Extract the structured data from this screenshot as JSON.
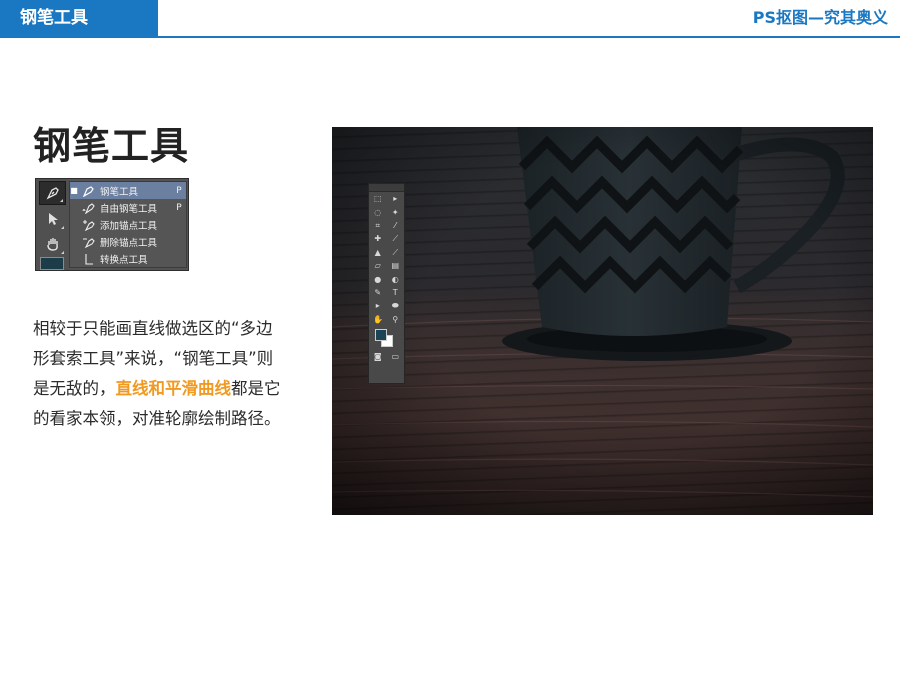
{
  "header": {
    "section_tab": "钢笔工具",
    "course_title": "PS抠图—究其奥义"
  },
  "main": {
    "title": "钢笔工具"
  },
  "pen_flyout": {
    "items": [
      {
        "label": "钢笔工具",
        "shortcut": "P",
        "selected": true
      },
      {
        "label": "自由钢笔工具",
        "shortcut": "P",
        "selected": false
      },
      {
        "label": "添加锚点工具",
        "shortcut": "",
        "selected": false
      },
      {
        "label": "删除锚点工具",
        "shortcut": "",
        "selected": false
      },
      {
        "label": "转换点工具",
        "shortcut": "",
        "selected": false
      }
    ]
  },
  "description": {
    "part1": "相较于只能画直线做选区的“多边形套索工具”来说，“钢笔工具”则是无敌的，",
    "highlight": "直线和平滑曲线",
    "part2": "都是它的看家本领，对准轮廓绘制路径。"
  },
  "colors": {
    "brand_blue": "#1a78c2",
    "highlight_orange": "#f19a21",
    "foreground_color": "#1d4356",
    "background_color": "#ffffff"
  },
  "icons": {
    "pen": "pen-icon",
    "move": "arrow-icon",
    "hand": "hand-icon"
  }
}
